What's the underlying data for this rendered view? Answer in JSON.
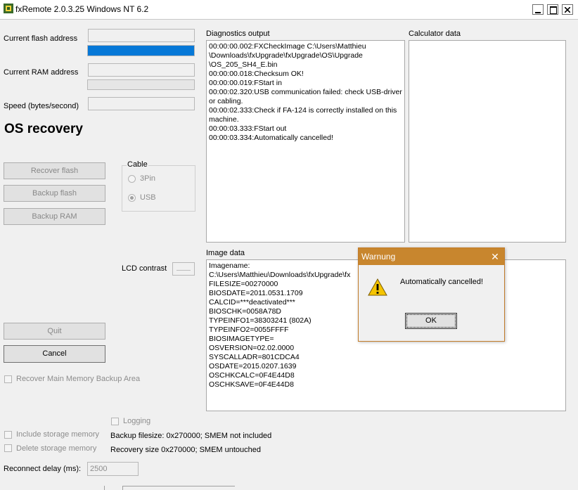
{
  "window": {
    "title": "fxRemote 2.0.3.25 Windows NT 6.2"
  },
  "left": {
    "current_flash_label": "Current flash address",
    "flash_progress": 1.0,
    "current_ram_label": "Current RAM address",
    "speed_label": "Speed (bytes/second)",
    "mode_title": "OS recovery",
    "recover_flash": "Recover flash",
    "backup_flash": "Backup flash",
    "backup_ram": "Backup RAM",
    "cable_title": "Cable",
    "cable_3pin": "3Pin",
    "cable_usb": "USB",
    "lcd_contrast": "LCD contrast",
    "quit": "Quit",
    "cancel": "Cancel",
    "recover_main_memory": "Recover Main Memory Backup Area",
    "logging": "Logging",
    "include_storage": "Include storage memory",
    "delete_storage": "Delete storage memory",
    "backup_filesize": "Backup filesize: 0x270000; SMEM not included",
    "recovery_size": "Recovery size 0x270000; SMEM untouched",
    "reconnect_label": "Reconnect delay (ms):",
    "reconnect_value": "2500"
  },
  "diagnostics": {
    "label": "Diagnostics output",
    "lines": [
      "00:00:00.002:FXCheckImage C:\\Users\\Matthieu \\Downloads\\fxUpgrade\\fxUpgrade\\OS\\Upgrade \\OS_205_SH4_E.bin",
      "00:00:00.018:Checksum OK!",
      "00:00:00.019:FStart in",
      "00:00:02.320:USB communication failed: check USB-driver or cabling.",
      "00:00:02.333:Check if FA-124 is correctly installed on this machine.",
      "00:00:03.333:FStart out",
      "00:00:03.334:Automatically cancelled!"
    ]
  },
  "calculator": {
    "label": "Calculator data"
  },
  "image": {
    "label": "Image data",
    "lines": [
      "Imagename:",
      "C:\\Users\\Matthieu\\Downloads\\fxUpgrade\\fx",
      "FILESIZE=00270000",
      "BIOSDATE=2011.0531.1709",
      "CALCID=***deactivated***",
      "BIOSCHK=0058A78D",
      "TYPEINFO1=38303241 (802A)",
      "TYPEINFO2=0055FFFF",
      "BIOSIMAGETYPE=",
      "OSVERSION=02.02.0000",
      "SYSCALLADR=801CDCA4",
      "OSDATE=2015.0207.1639",
      "OSCHKCALC=0F4E44D8",
      "OSCHKSAVE=0F4E44D8"
    ]
  },
  "dialog": {
    "title": "Warnung",
    "close": "✕",
    "message": "Automatically cancelled!",
    "ok": "OK"
  },
  "colors": {
    "accent": "#0678d7",
    "dialog_title": "#c8862e"
  }
}
